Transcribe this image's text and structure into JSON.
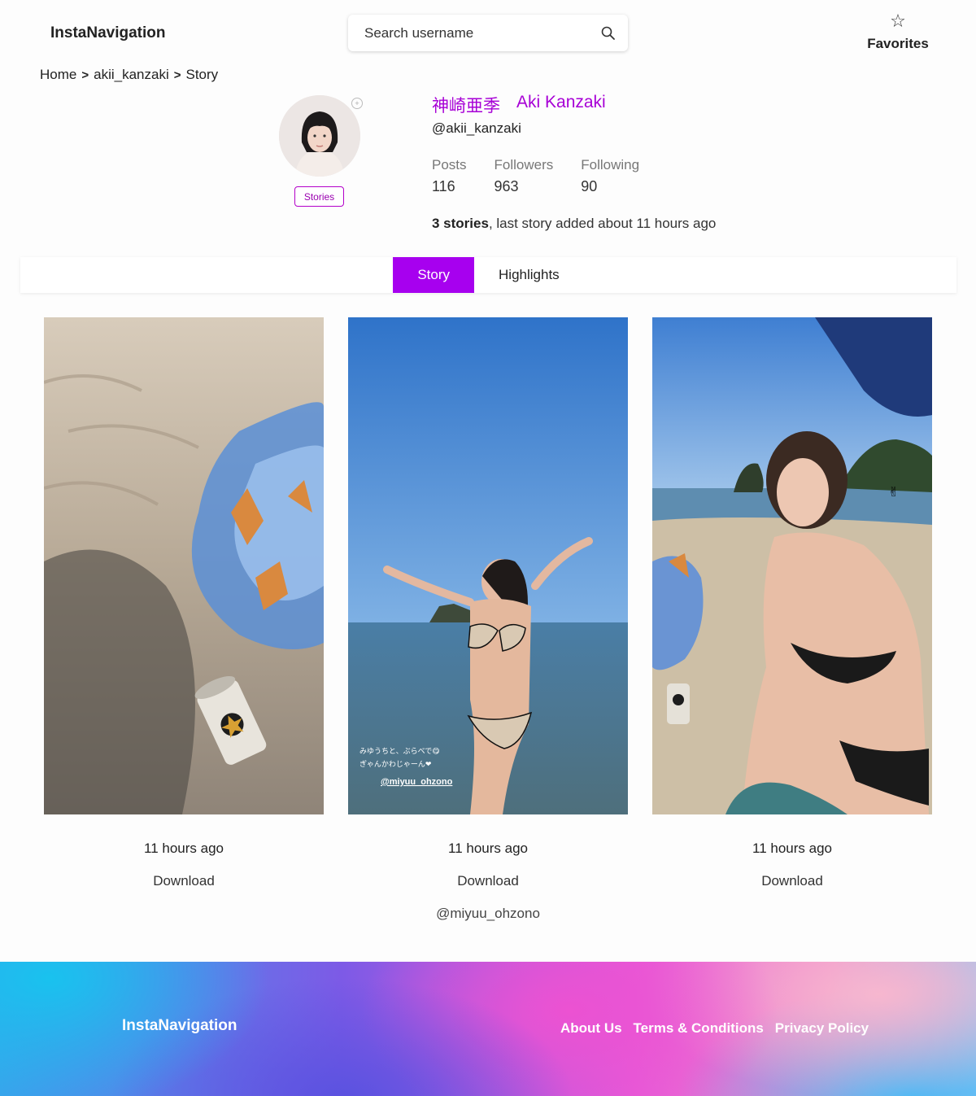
{
  "header": {
    "brand": "InstaNavigation",
    "search_placeholder": "Search username",
    "favorites_label": "Favorites"
  },
  "breadcrumb": [
    "Home",
    "akii_kanzaki",
    "Story"
  ],
  "profile": {
    "name_jp": "神崎亜季",
    "name_en": "Aki Kanzaki",
    "handle": "@akii_kanzaki",
    "stories_button": "Stories",
    "stats": [
      {
        "label": "Posts",
        "value": "116"
      },
      {
        "label": "Followers",
        "value": "963"
      },
      {
        "label": "Following",
        "value": "90"
      }
    ],
    "summary_bold": "3 stories",
    "summary_rest": ", last story added about 11 hours ago"
  },
  "tabs": [
    {
      "label": "Story",
      "active": true
    },
    {
      "label": "Highlights",
      "active": false
    }
  ],
  "stories": [
    {
      "time": "11 hours ago",
      "download": "Download",
      "mention": ""
    },
    {
      "time": "11 hours ago",
      "download": "Download",
      "mention": "@miyuu_ohzono",
      "overlay_line1": "みゆうちと、ぶらべで😋",
      "overlay_line2": "ぎゃんかわじゃーん❤",
      "overlay_tag": "@miyuu_ohzono"
    },
    {
      "time": "11 hours ago",
      "download": "Download",
      "mention": ""
    }
  ],
  "footer": {
    "brand": "InstaNavigation",
    "links": [
      "About Us",
      "Terms & Conditions",
      "Privacy Policy"
    ]
  },
  "colors": {
    "accent": "#a700ef",
    "name": "#a700d6"
  }
}
